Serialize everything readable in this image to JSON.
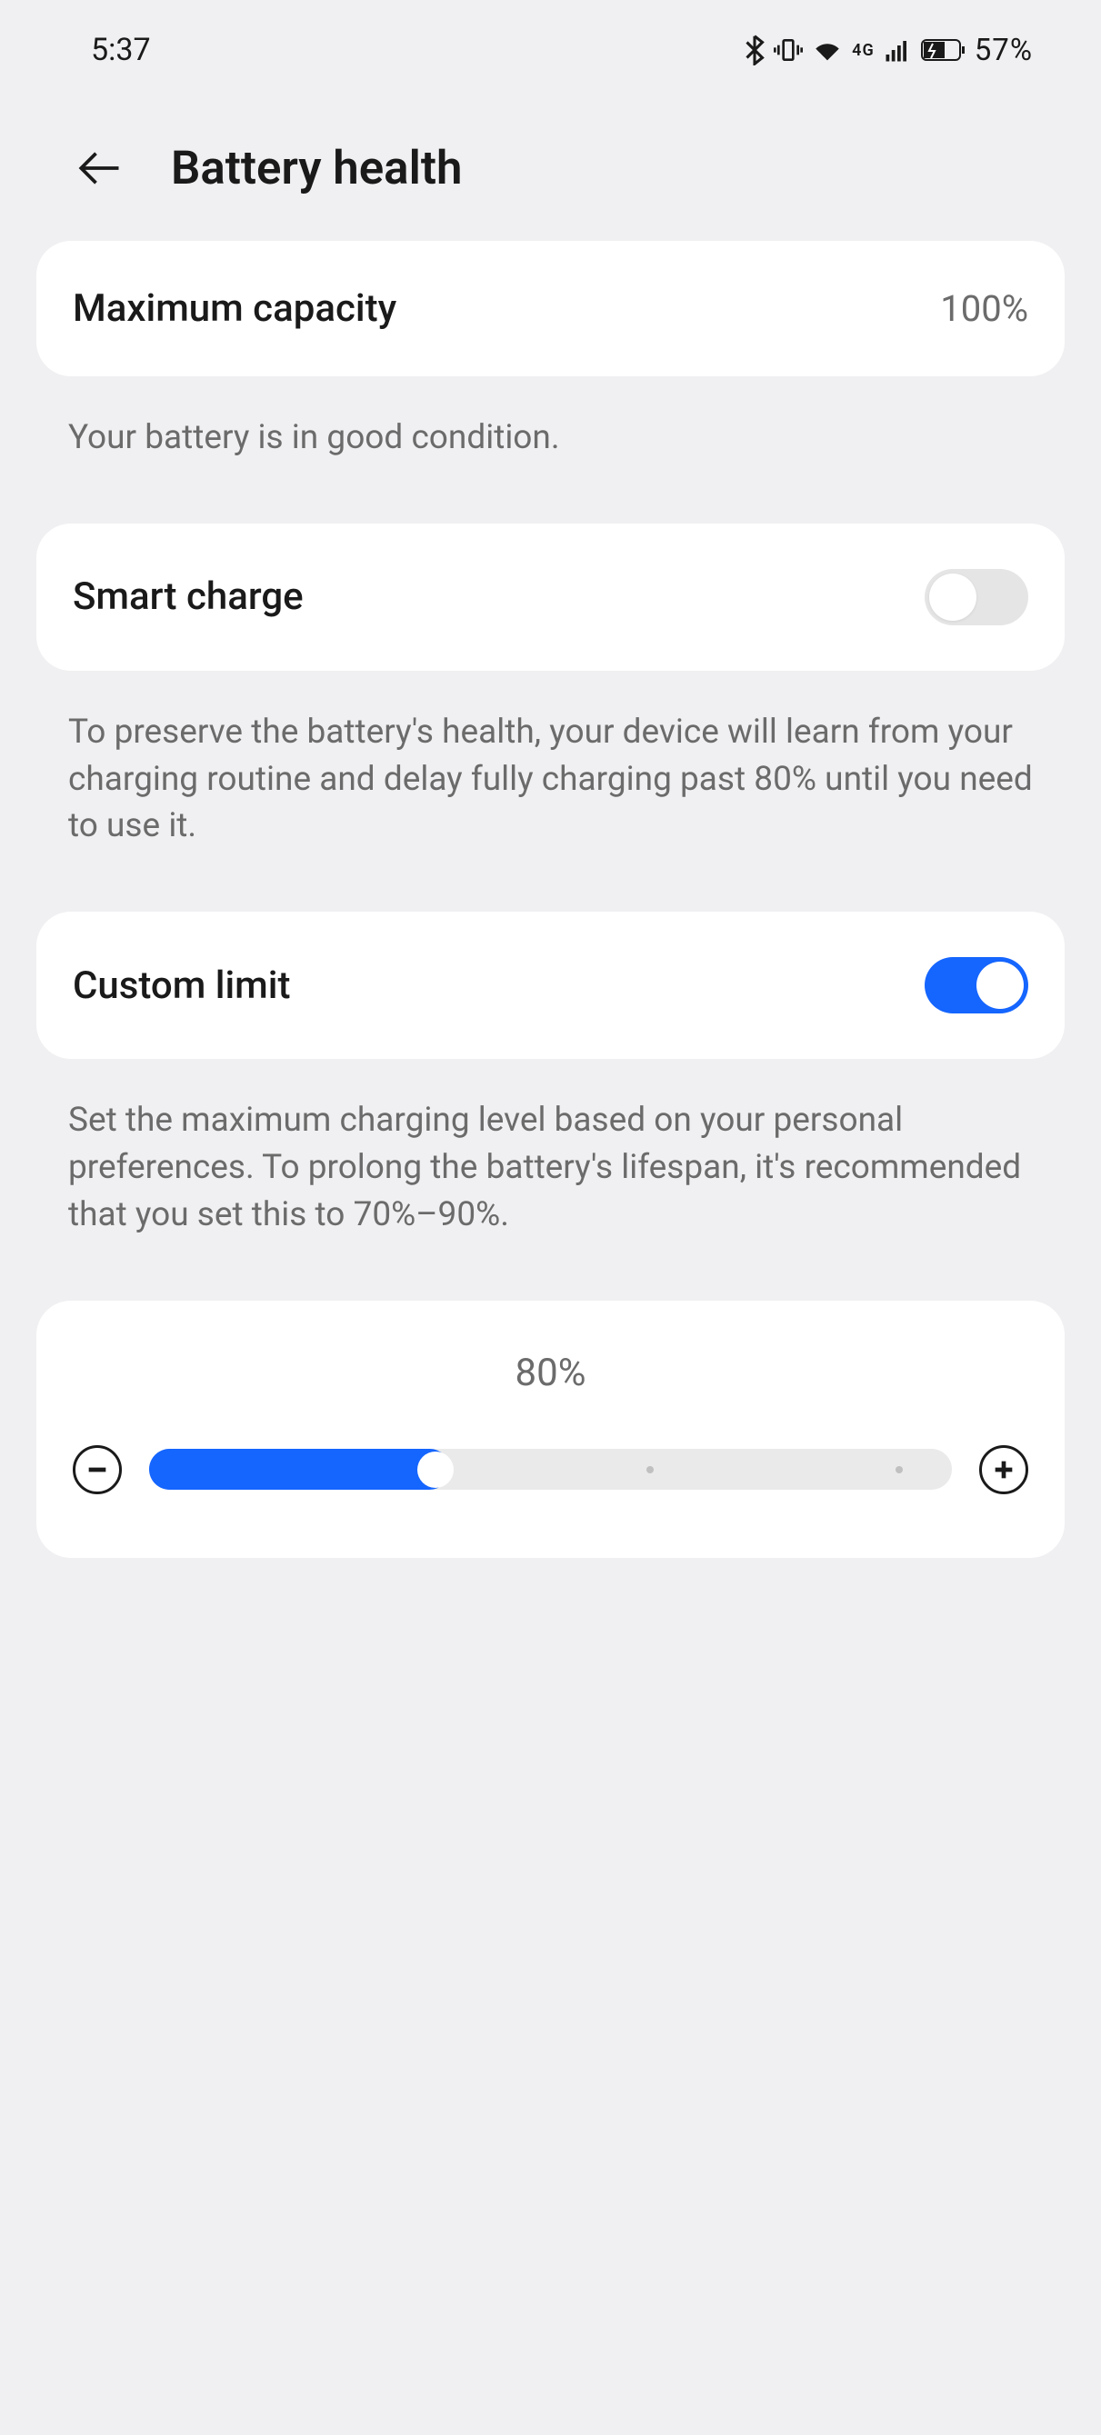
{
  "statusBar": {
    "time": "5:37",
    "networkLabel": "4G",
    "batteryPercent": "57%"
  },
  "header": {
    "title": "Battery health"
  },
  "maxCapacity": {
    "label": "Maximum capacity",
    "value": "100%",
    "description": "Your battery is in good condition."
  },
  "smartCharge": {
    "label": "Smart charge",
    "enabled": false,
    "description": "To preserve the battery's health, your device will learn from your charging routine and delay fully charging past 80% until you need to use it."
  },
  "customLimit": {
    "label": "Custom limit",
    "enabled": true,
    "description": "Set the maximum charging level based on your personal preferences. To prolong the battery's lifespan, it's recommended that you set this to 70%–90%."
  },
  "slider": {
    "value": "80%",
    "min": 60,
    "max": 100,
    "current": 80
  }
}
